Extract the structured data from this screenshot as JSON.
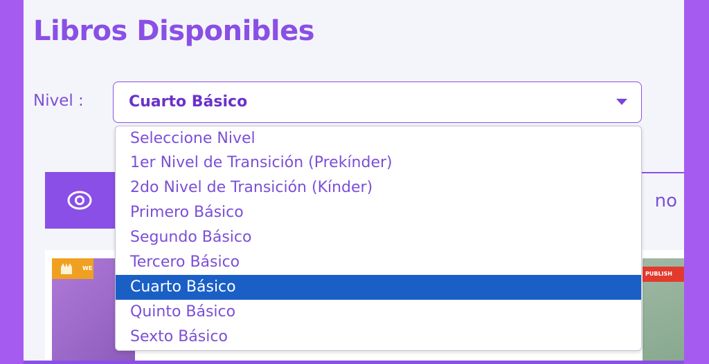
{
  "header": {
    "title": "Libros Disponibles"
  },
  "filter": {
    "label": "Nivel :",
    "selected": "Cuarto Básico",
    "options": [
      "Seleccione Nivel",
      "1er Nivel de Transición (Prekínder)",
      "2do Nivel de Transición (Kínder)",
      "Primero Básico",
      "Segundo Básico",
      "Tercero Básico",
      "Cuarto Básico",
      "Quinto Básico",
      "Sexto Básico"
    ],
    "selected_index": 6
  },
  "tabs": {
    "right_partial_text": "no"
  },
  "cards": {
    "left_badge_text": "WE",
    "right_badge_text": "PUBLISH"
  },
  "colors": {
    "accent": "#8a4fe6",
    "selected_option": "#1a5fc6",
    "page_bg": "#a55bf0",
    "panel_bg": "#f4f5fa"
  },
  "icons": {
    "eye": "eye-icon",
    "caret": "chevron-down-icon"
  }
}
